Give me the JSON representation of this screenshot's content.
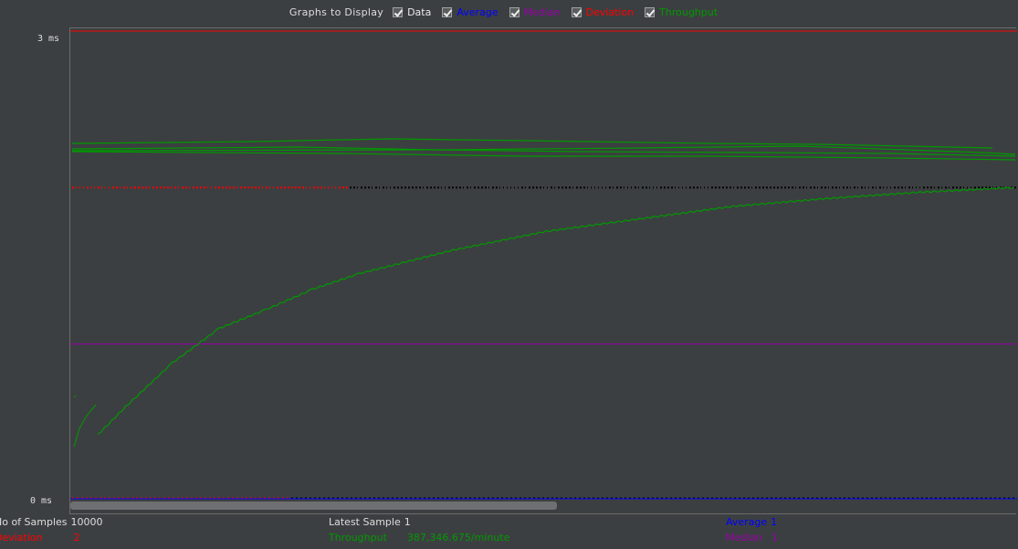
{
  "toolbar": {
    "title": "Graphs to Display",
    "checks": [
      {
        "label": "Data",
        "color": "#e8e8e8",
        "checked": true
      },
      {
        "label": "Average",
        "color": "#0000ff",
        "checked": true
      },
      {
        "label": "Median",
        "color": "#9900aa",
        "checked": true
      },
      {
        "label": "Deviation",
        "color": "#ff0000",
        "checked": true
      },
      {
        "label": "Throughput",
        "color": "#009900",
        "checked": true
      }
    ]
  },
  "axis": {
    "top_label": "3 ms",
    "bottom_label": "0 ms"
  },
  "stats": {
    "samples_label": "No of Samples",
    "samples_value": "10000",
    "latest_label": "Latest Sample",
    "latest_value": "1",
    "average_label": "Average",
    "average_value": "1",
    "deviation_label": "Deviation",
    "deviation_value": "2",
    "throughput_label": "Throughput",
    "throughput_value": "387,346.675/minute",
    "median_label": "Median",
    "median_value": "1"
  },
  "colors": {
    "background": "#3c3f41",
    "data": "#000000",
    "average": "#0000ff",
    "median": "#9900aa",
    "deviation": "#ff0000",
    "throughput": "#009900"
  },
  "chart_data": {
    "type": "line",
    "ylim": [
      0,
      3
    ],
    "y_unit": "ms",
    "samples": 10000,
    "series": [
      {
        "name": "Median",
        "values": [
          1,
          1
        ]
      },
      {
        "name": "Deviation",
        "values": [
          3,
          3
        ]
      },
      {
        "name": "Throughput",
        "x": [
          0.02,
          0.05,
          0.1,
          0.15,
          0.2,
          0.25,
          0.3,
          0.4,
          0.5,
          0.6,
          0.7,
          0.8,
          0.9,
          1.0
        ],
        "values": [
          0.42,
          0.6,
          0.88,
          1.1,
          1.22,
          1.35,
          1.45,
          1.6,
          1.72,
          1.8,
          1.88,
          1.93,
          1.97,
          2.0
        ]
      }
    ]
  }
}
